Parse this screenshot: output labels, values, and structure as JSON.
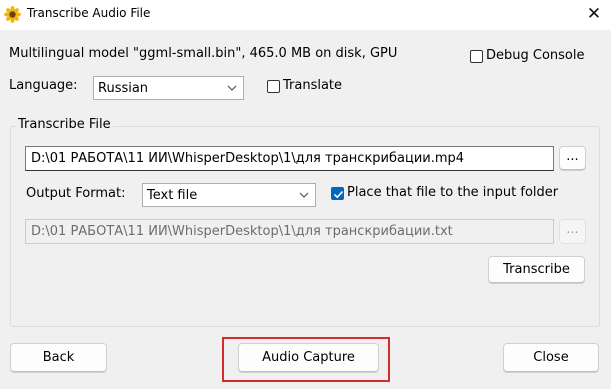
{
  "window": {
    "title": "Transcribe Audio File",
    "close_glyph": "✕"
  },
  "model_info": "Multilingual model \"ggml-small.bin\", 465.0 MB on disk, GPU",
  "debug_console": {
    "label": "Debug Console",
    "checked": false
  },
  "language": {
    "label": "Language:",
    "value": "Russian"
  },
  "translate": {
    "label": "Translate",
    "checked": false
  },
  "transcribe_group": {
    "title": "Transcribe File",
    "input_path": "D:\\01 РАБОТА\\11 ИИ\\WhisperDesktop\\1\\для транскрибации.mp4",
    "browse_label": "...",
    "output_format_label": "Output Format:",
    "output_format_value": "Text file",
    "place_in_input_folder": {
      "label": "Place that file to the input folder",
      "checked": true
    },
    "output_path": "D:\\01 РАБОТА\\11 ИИ\\WhisperDesktop\\1\\для транскрибации.txt",
    "output_browse_label": "...",
    "transcribe_label": "Transcribe"
  },
  "footer": {
    "back_label": "Back",
    "audio_capture_label": "Audio Capture",
    "close_label": "Close"
  },
  "colors": {
    "accent": "#0067c0",
    "highlight": "#d42b2b",
    "icon_yellow": "#f2b705"
  }
}
